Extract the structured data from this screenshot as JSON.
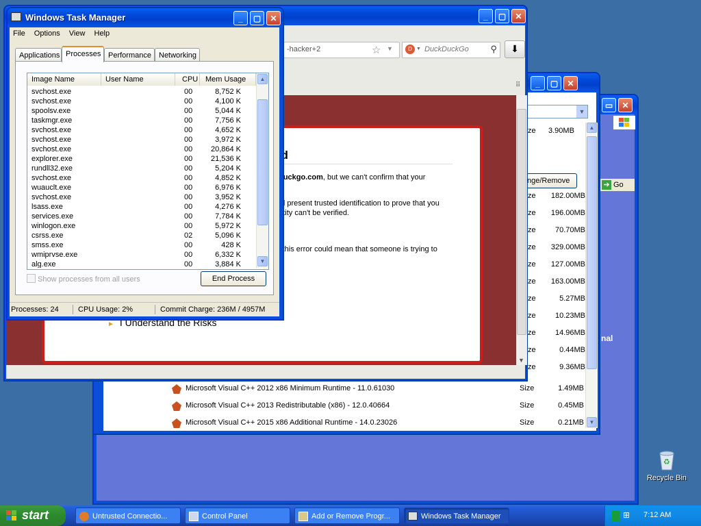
{
  "desktop": {
    "recycle_bin_label": "Recycle Bin",
    "bg_color": "#3a6ea5"
  },
  "browser": {
    "url_fragment": "-hacker+2",
    "search_placeholder": "DuckDuckGo",
    "error_title_fragment": "ed",
    "line1_bold": "xduckgo.com",
    "line1_rest": ", but we can't confirm that your",
    "line2a": "will present trusted identification to prove that you",
    "line2b": "entity can't be verified.",
    "line3": "s, this error could mean that someone is trying to",
    "understand_risks": "I Understand the Risks"
  },
  "control_panel": {
    "partial_label": "nal",
    "go_label": "Go"
  },
  "add_remove": {
    "change_remove_label": "nge/Remove",
    "size_label": "Size",
    "size_partial_label": "ze",
    "top_size": "3.90MB",
    "sizes": [
      "182.00MB",
      "196.00MB",
      "70.70MB",
      "329.00MB",
      "127.00MB",
      "163.00MB",
      "5.27MB",
      "10.23MB",
      "14.96MB",
      "0.44MB",
      "9.36MB"
    ],
    "programs": [
      {
        "name": "Microsoft Visual C++ 2012 x86 Minimum Runtime - 11.0.61030",
        "size": "1.49MB"
      },
      {
        "name": "Microsoft Visual C++ 2013 Redistributable (x86) - 12.0.40664",
        "size": "0.45MB"
      },
      {
        "name": "Microsoft Visual C++ 2015 x86 Additional Runtime - 14.0.23026",
        "size": "0.21MB"
      }
    ]
  },
  "taskmgr": {
    "title": "Windows Task Manager",
    "menu": [
      "File",
      "Options",
      "View",
      "Help"
    ],
    "tabs": [
      "Applications",
      "Processes",
      "Performance",
      "Networking"
    ],
    "columns": [
      "Image Name",
      "User Name",
      "CPU",
      "Mem Usage"
    ],
    "processes": [
      {
        "name": "svchost.exe",
        "cpu": "00",
        "mem": "8,752 K"
      },
      {
        "name": "svchost.exe",
        "cpu": "00",
        "mem": "4,100 K"
      },
      {
        "name": "spoolsv.exe",
        "cpu": "00",
        "mem": "5,044 K"
      },
      {
        "name": "taskmgr.exe",
        "cpu": "00",
        "mem": "7,756 K"
      },
      {
        "name": "svchost.exe",
        "cpu": "00",
        "mem": "4,652 K"
      },
      {
        "name": "svchost.exe",
        "cpu": "00",
        "mem": "3,972 K"
      },
      {
        "name": "svchost.exe",
        "cpu": "00",
        "mem": "20,864 K"
      },
      {
        "name": "explorer.exe",
        "cpu": "00",
        "mem": "21,536 K"
      },
      {
        "name": "rundll32.exe",
        "cpu": "00",
        "mem": "5,204 K"
      },
      {
        "name": "svchost.exe",
        "cpu": "00",
        "mem": "4,852 K"
      },
      {
        "name": "wuauclt.exe",
        "cpu": "00",
        "mem": "6,976 K"
      },
      {
        "name": "svchost.exe",
        "cpu": "00",
        "mem": "3,952 K"
      },
      {
        "name": "lsass.exe",
        "cpu": "00",
        "mem": "4,276 K"
      },
      {
        "name": "services.exe",
        "cpu": "00",
        "mem": "7,784 K"
      },
      {
        "name": "winlogon.exe",
        "cpu": "00",
        "mem": "5,972 K"
      },
      {
        "name": "csrss.exe",
        "cpu": "02",
        "mem": "5,096 K"
      },
      {
        "name": "smss.exe",
        "cpu": "00",
        "mem": "428 K"
      },
      {
        "name": "wmiprvse.exe",
        "cpu": "00",
        "mem": "6,332 K"
      },
      {
        "name": "alg.exe",
        "cpu": "00",
        "mem": "3,884 K"
      }
    ],
    "show_all_label": "Show processes from all users",
    "end_process_label": "End Process",
    "status": {
      "processes": "Processes: 24",
      "cpu": "CPU Usage: 2%",
      "commit": "Commit Charge: 236M / 4957M"
    }
  },
  "taskbar": {
    "start_label": "start",
    "buttons": [
      "Untrusted Connectio...",
      "Control Panel",
      "Add or Remove Progr...",
      "Windows Task Manager"
    ],
    "clock": "7:12 AM"
  }
}
